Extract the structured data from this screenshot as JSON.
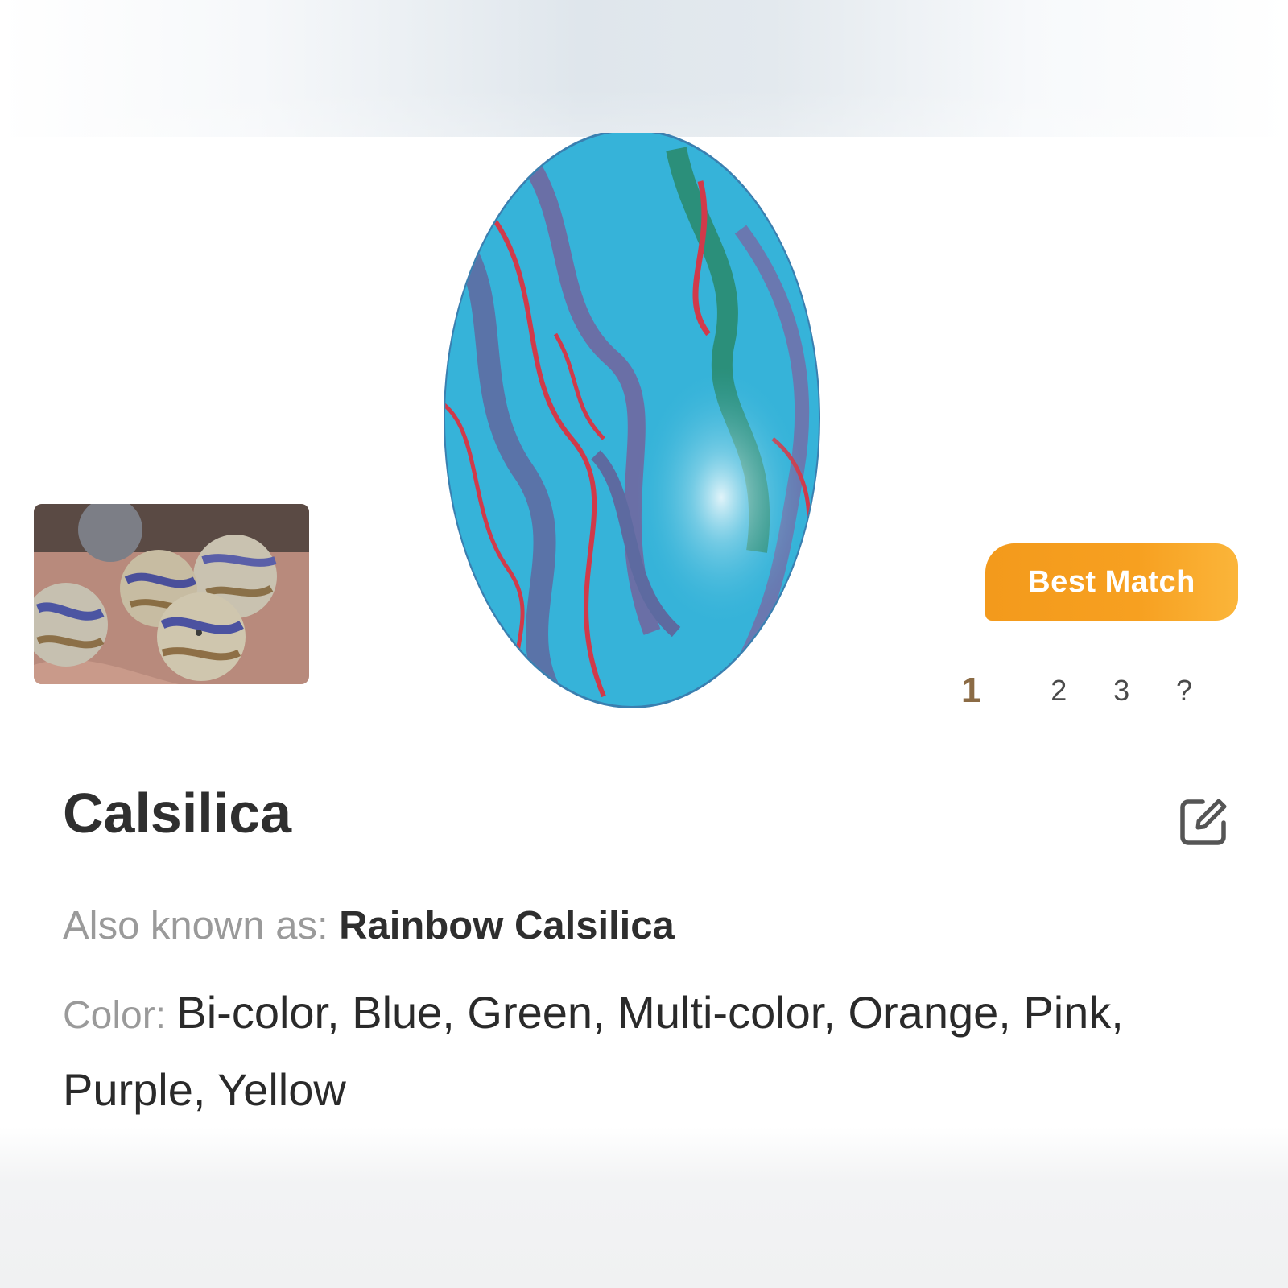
{
  "result": {
    "badge": "Best Match",
    "pages": [
      "1",
      "2",
      "3",
      "?"
    ]
  },
  "stone": {
    "name": "Calsilica",
    "aka_label": "Also known as:",
    "aka_value": "Rainbow Calsilica",
    "color_label": "Color:",
    "color_value": "Bi-color, Blue, Green, Multi-color, Orange, Pink, Purple, Yellow"
  },
  "icons": {
    "edit": "edit-icon"
  },
  "colors": {
    "badge": "#f7a020",
    "active_page": "#8b6b45",
    "label": "#9a9a9a",
    "text": "#2b2b2b"
  }
}
